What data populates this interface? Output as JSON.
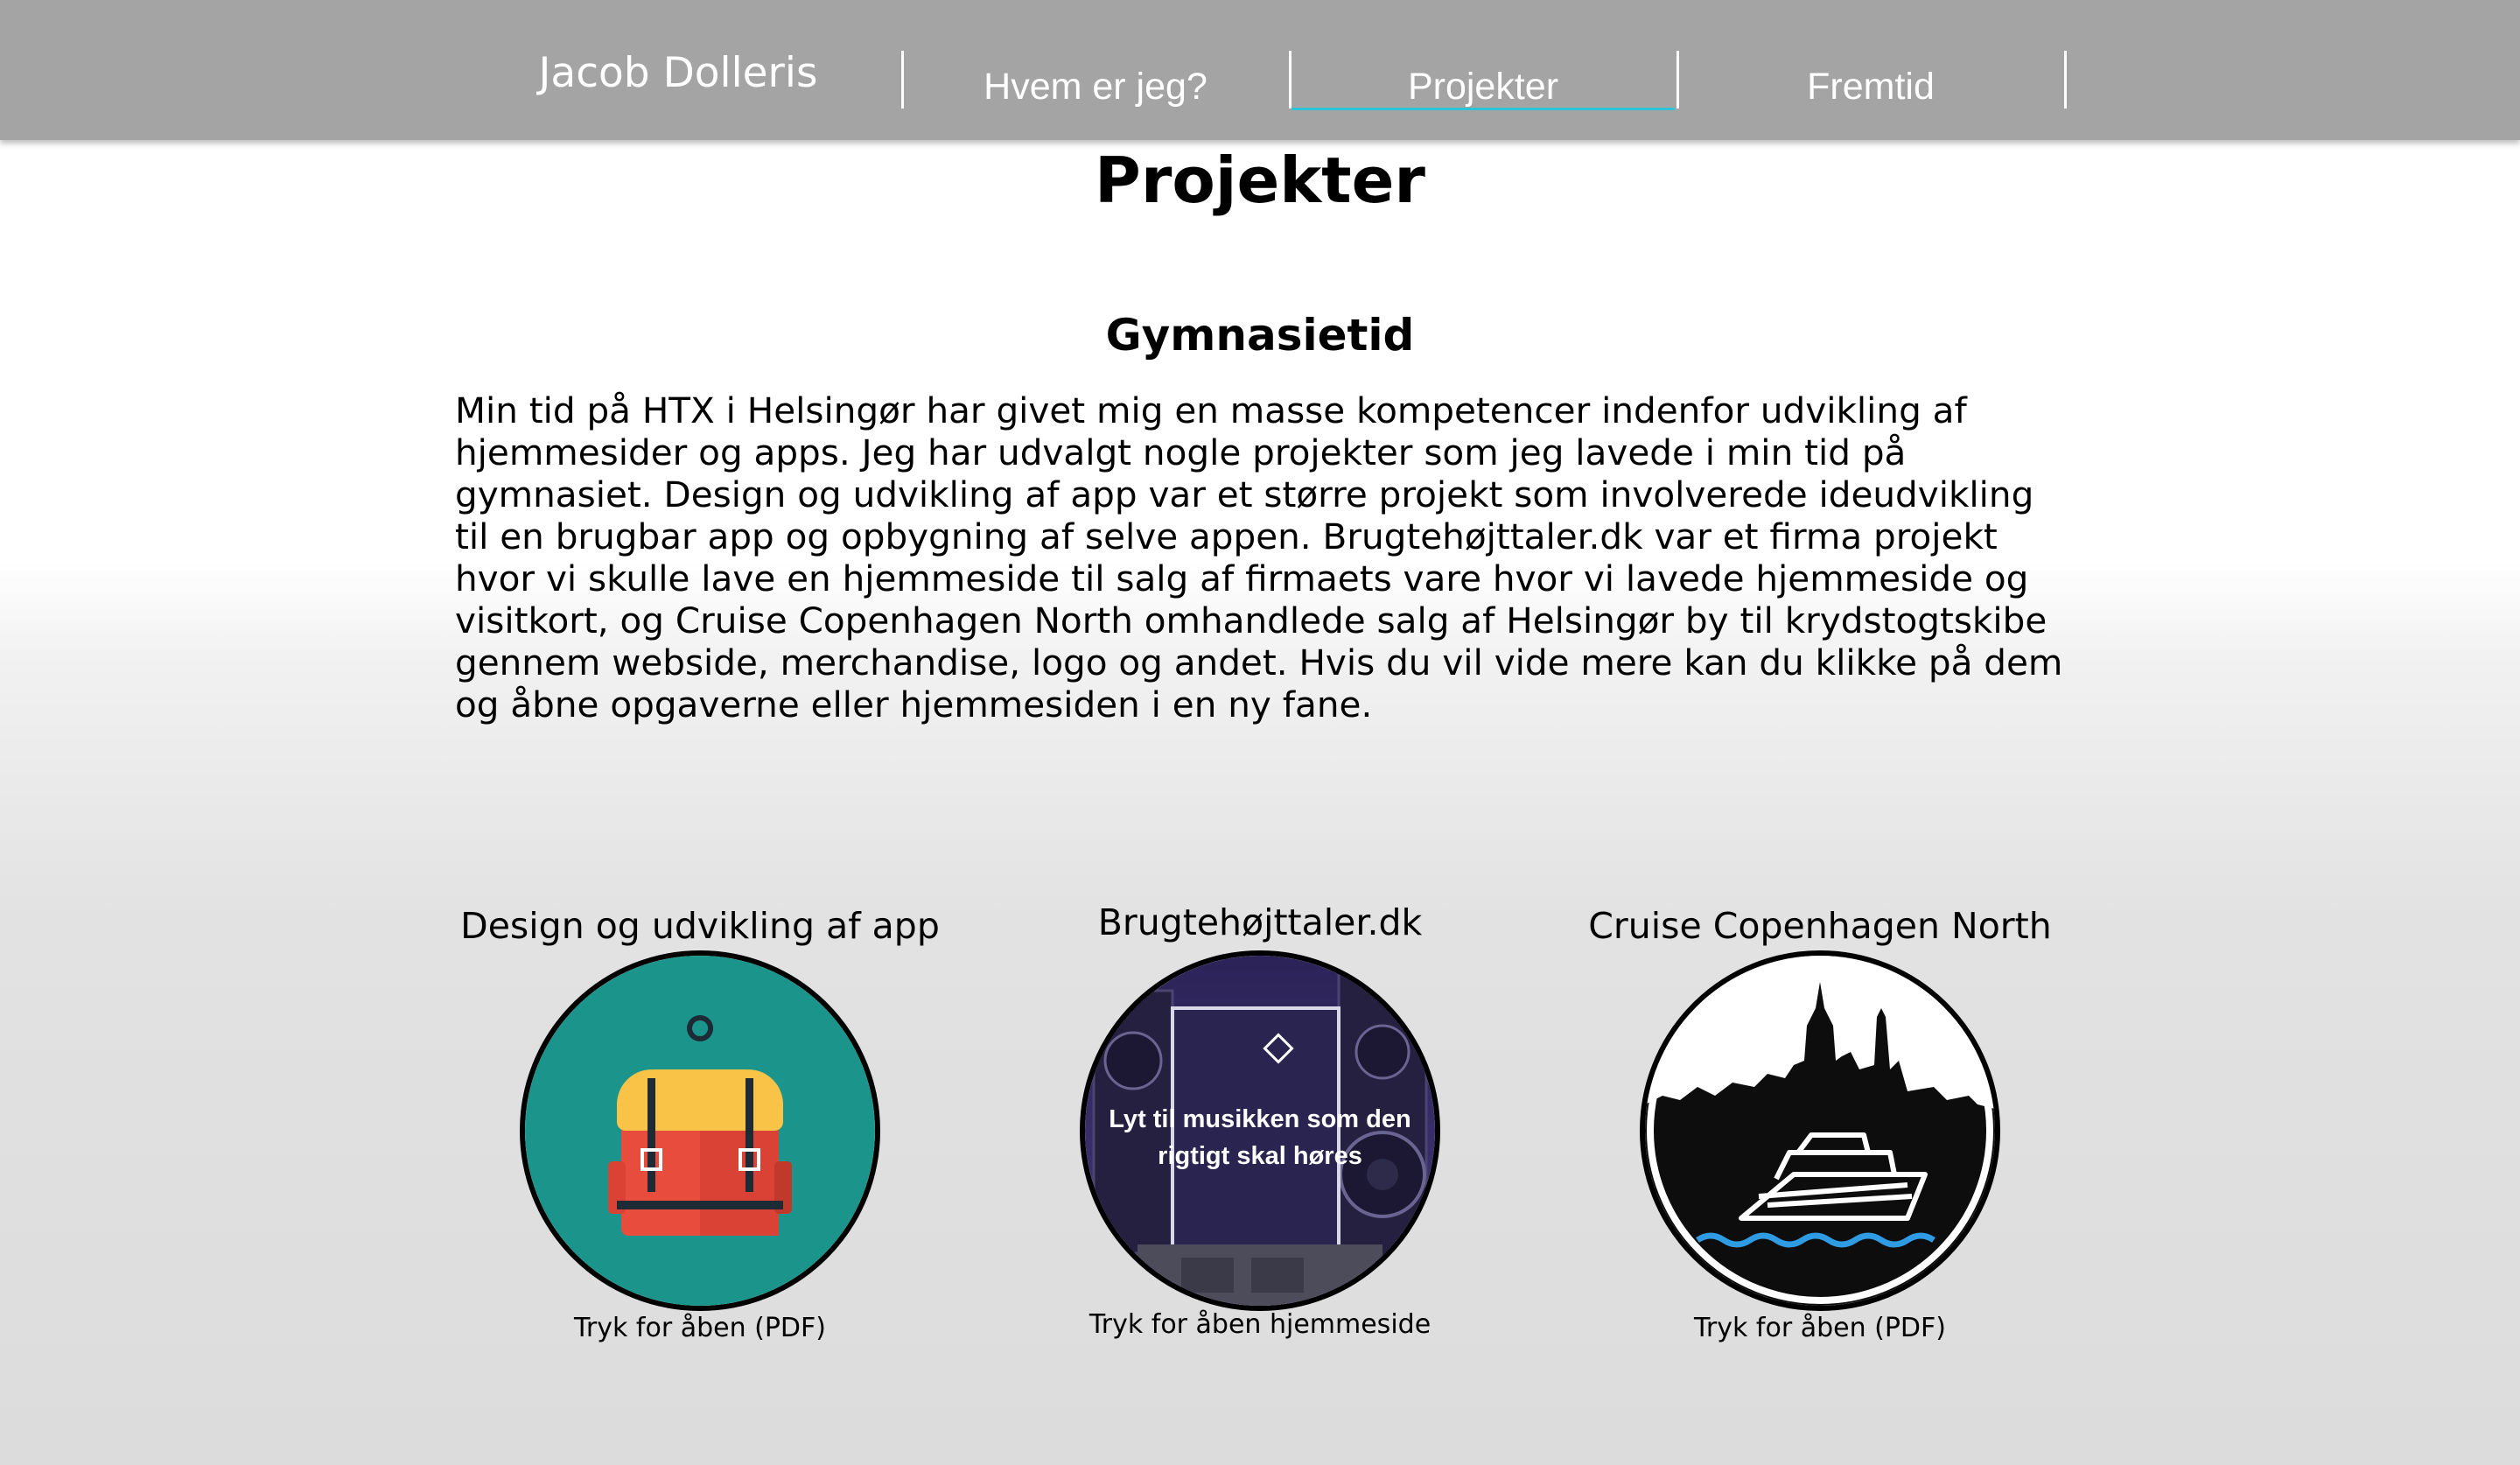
{
  "nav": {
    "brand": "Jacob Dolleris",
    "links": [
      {
        "label": "Hvem er jeg?"
      },
      {
        "label": "Projekter",
        "active": true
      },
      {
        "label": "Fremtid"
      }
    ],
    "active_underline_color": "#2ec3d6",
    "bar_color": "#a4a4a4"
  },
  "main": {
    "title": "Projekter",
    "section_title": "Gymnasietid",
    "intro": "Min tid på HTX i Helsingør har givet mig en masse kompetencer indenfor udvikling af hjemmesider og apps. Jeg har udvalgt nogle projekter som jeg lavede i min tid på gymnasiet. Design og udvikling af app var et større projekt som involverede ideudvikling til en brugbar app og opbygning af selve appen. Brugtehøjttaler.dk var et firma projekt hvor vi skulle lave en hjemmeside til salg af firmaets vare hvor vi lavede hjemmeside og visitkort, og Cruise Copenhagen North omhandlede salg af Helsingør by til krydstogtskibe gennem webside, merchandise, logo og andet. Hvis du vil vide mere kan du klikke på dem og åbne opgaverne eller hjemmesiden i en ny fane."
  },
  "projects": [
    {
      "title": "Design og udvikling af app",
      "caption": "Tryk for åben (PDF)",
      "icon": "backpack-icon",
      "bg_color": "#1b958b"
    },
    {
      "title": "Brugtehøjttaler.dk",
      "caption": "Tryk for åben hjemmeside",
      "icon": "speaker-image",
      "overlay_text_line1": "Lyt til musikken som den",
      "overlay_text_line2": "rigtigt skal høres",
      "bg_color": "#3b2f6b"
    },
    {
      "title": "Cruise Copenhagen North",
      "caption": "Tryk for åben (PDF)",
      "icon": "cruise-ship-logo",
      "bg_color": "#0d0d0d"
    }
  ]
}
